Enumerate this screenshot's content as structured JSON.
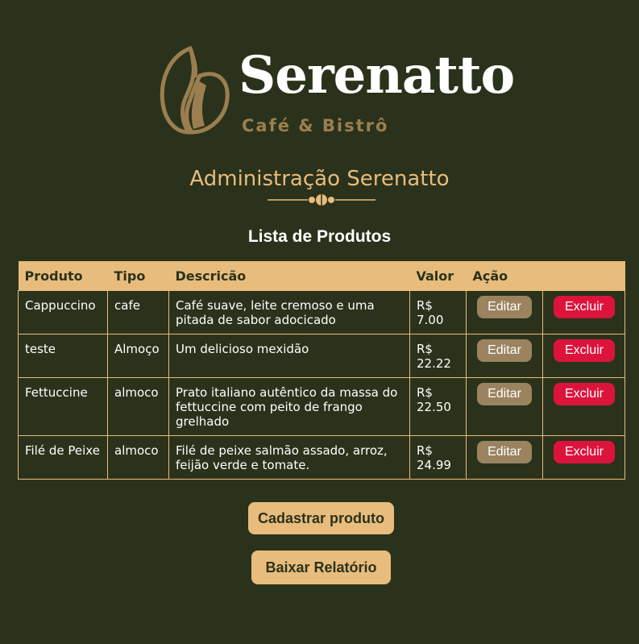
{
  "brand": {
    "name": "Serenatto",
    "subtitle": "Café & Bistrô"
  },
  "header": {
    "admin_title": "Administração Serenatto",
    "list_title": "Lista de Produtos"
  },
  "table": {
    "columns": [
      "Produto",
      "Tipo",
      "Descricão",
      "Valor",
      "Ação"
    ],
    "rows": [
      {
        "produto": "Cappuccino",
        "tipo": "cafe",
        "descricao": "Café suave, leite cremoso e uma pitada de sabor adocicado",
        "valor": "R$ 7.00"
      },
      {
        "produto": "teste",
        "tipo": "Almoço",
        "descricao": "Um delicioso mexidão",
        "valor": "R$ 22.22"
      },
      {
        "produto": "Fettuccine",
        "tipo": "almoco",
        "descricao": "Prato italiano autêntico da massa do fettuccine com peito de frango grelhado",
        "valor": "R$ 22.50"
      },
      {
        "produto": "Filé de Peixe",
        "tipo": "almoco",
        "descricao": "Filé de peixe salmão assado, arroz, feijão verde e tomate.",
        "valor": "R$ 24.99"
      }
    ],
    "edit_label": "Editar",
    "delete_label": "Excluir"
  },
  "actions": {
    "register_label": "Cadastrar produto",
    "report_label": "Baixar Relatório"
  },
  "colors": {
    "background": "#2b321b",
    "accent": "#e8bc7c",
    "edit": "#9b8360",
    "delete": "#dc143c"
  }
}
